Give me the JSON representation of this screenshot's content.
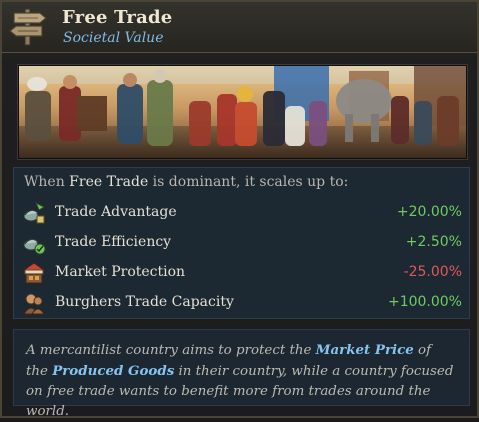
{
  "header": {
    "title": "Free Trade",
    "subtitle": "Societal Value",
    "icon": "signpost-icon"
  },
  "illustration": {
    "icon": "marketplace-painting"
  },
  "effects": {
    "intro_before": "When ",
    "intro_highlight": "Free Trade",
    "intro_after": " is dominant, it scales up to:",
    "items": [
      {
        "label": "Trade Advantage",
        "value": "+20.00%",
        "icon": "trade-advantage-icon",
        "sign": "positive"
      },
      {
        "label": "Trade Efficiency",
        "value": "+2.50%",
        "icon": "trade-efficiency-icon",
        "sign": "positive"
      },
      {
        "label": "Market Protection",
        "value": "-25.00%",
        "icon": "market-stall-icon",
        "sign": "negative"
      },
      {
        "label": "Burghers Trade Capacity",
        "value": "+100.00%",
        "icon": "burghers-icon",
        "sign": "positive"
      }
    ]
  },
  "description": {
    "p1": "A mercantilist country aims to protect the ",
    "link1": "Market Price",
    "p2": " of the ",
    "link2": "Produced Goods",
    "p3": " in their country, while a country focused on free trade wants to benefit more from trades around the world."
  },
  "colors": {
    "positive": "#6fcb62",
    "negative": "#e0575a",
    "highlight": "#86c4ee",
    "subtitle": "#7fb9e3"
  }
}
